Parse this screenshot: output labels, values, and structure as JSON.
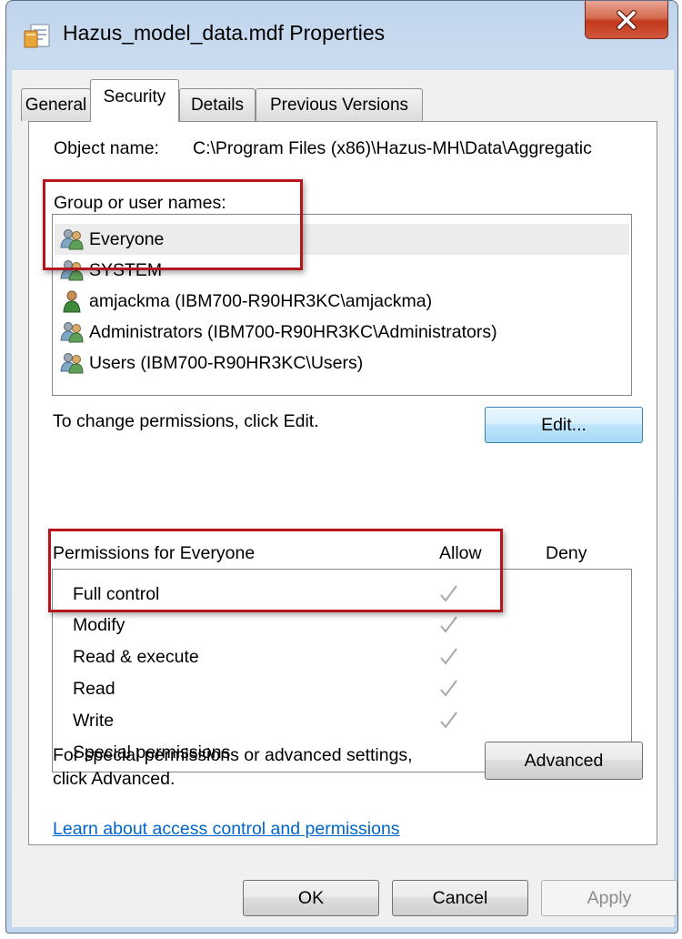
{
  "window": {
    "title": "Hazus_model_data.mdf Properties",
    "icons": {
      "app": "file-properties-icon",
      "close": "close-icon"
    }
  },
  "tabs": [
    {
      "label": "General",
      "active": false
    },
    {
      "label": "Security",
      "active": true
    },
    {
      "label": "Details",
      "active": false
    },
    {
      "label": "Previous Versions",
      "active": false
    }
  ],
  "security": {
    "object_name_label": "Object name:",
    "object_name_value": "C:\\Program Files (x86)\\Hazus-MH\\Data\\Aggregatic",
    "group_label": "Group or user names:",
    "users": [
      {
        "name": "Everyone",
        "icon": "group-users-icon",
        "selected": true
      },
      {
        "name": "SYSTEM",
        "icon": "group-users-icon",
        "selected": false
      },
      {
        "name": "amjackma (IBM700-R90HR3KC\\amjackma)",
        "icon": "user-icon",
        "selected": false
      },
      {
        "name": "Administrators (IBM700-R90HR3KC\\Administrators)",
        "icon": "group-users-icon",
        "selected": false
      },
      {
        "name": "Users (IBM700-R90HR3KC\\Users)",
        "icon": "group-users-icon",
        "selected": false
      }
    ],
    "change_hint": "To change permissions, click Edit.",
    "edit_button": "Edit...",
    "permissions_header": "Permissions for Everyone",
    "allow_header": "Allow",
    "deny_header": "Deny",
    "permissions": [
      {
        "name": "Full control",
        "allow": true,
        "deny": false
      },
      {
        "name": "Modify",
        "allow": true,
        "deny": false
      },
      {
        "name": "Read & execute",
        "allow": true,
        "deny": false
      },
      {
        "name": "Read",
        "allow": true,
        "deny": false
      },
      {
        "name": "Write",
        "allow": true,
        "deny": false
      },
      {
        "name": "Special permissions",
        "allow": false,
        "deny": false
      }
    ],
    "advanced_hint_line1": "For special permissions or advanced settings,",
    "advanced_hint_line2": "click Advanced.",
    "advanced_button": "Advanced",
    "learn_link": "Learn about access control and permissions"
  },
  "footer": {
    "ok": "OK",
    "cancel": "Cancel",
    "apply": "Apply",
    "apply_enabled": false
  },
  "colors": {
    "highlight_border": "#b5161e",
    "check_color": "#a8a8a8",
    "link_color": "#0066cc",
    "selection": "#ececec"
  }
}
